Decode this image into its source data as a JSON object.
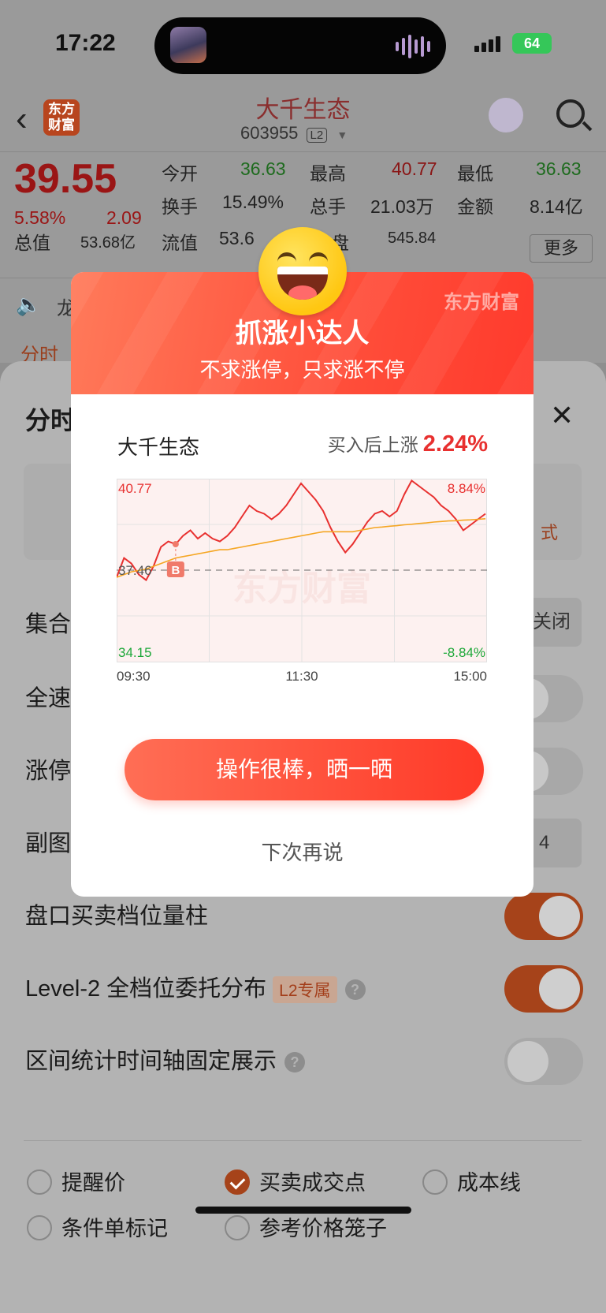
{
  "status": {
    "time": "17:22",
    "battery": "64"
  },
  "nav": {
    "logo_text": "东方\n财富",
    "stock_name": "大千生态",
    "stock_code": "603955",
    "l2_tag": "L2"
  },
  "quote": {
    "price": "39.55",
    "change_pct": "5.58%",
    "change_amt": "2.09",
    "open_label": "今开",
    "open_value": "36.63",
    "high_label": "最高",
    "high_value": "40.77",
    "low_label": "最低",
    "low_value": "36.63",
    "turnover_label": "换手",
    "turnover_value": "15.49%",
    "volume_label": "总手",
    "volume_value": "21.03万",
    "amount_label": "金额",
    "amount_value": "8.14亿",
    "mktcap_label": "总值",
    "mktcap_value": "53.68亿",
    "float_label": "流值",
    "float_value": "53.6",
    "extra_label": "盘",
    "extra_value": "545.84",
    "more_label": "更多"
  },
  "ticker": {
    "text": "龙"
  },
  "tab_partial": "分时",
  "sheet": {
    "title": "分时",
    "rows": [
      {
        "label": "集合",
        "control": "seg",
        "value": "关闭"
      },
      {
        "label": "全速",
        "control": "switch-off"
      },
      {
        "label": "涨停",
        "control": "switch-off"
      },
      {
        "label": "副图",
        "control": "seg",
        "value": "4"
      },
      {
        "label": "盘口买卖档位量柱",
        "control": "switch-on"
      },
      {
        "label": "Level-2 全档位委托分布",
        "badge": "L2专属",
        "help": "?",
        "control": "switch-on"
      },
      {
        "label": "区间统计时间轴固定展示",
        "help": "?",
        "control": "switch-off"
      }
    ],
    "seg_suffix": "式",
    "options": [
      {
        "label": "提醒价",
        "checked": false
      },
      {
        "label": "买卖成交点",
        "checked": true
      },
      {
        "label": "成本线",
        "checked": false
      },
      {
        "label": "条件单标记",
        "checked": false
      },
      {
        "label": "参考价格笼子",
        "checked": false
      }
    ]
  },
  "modal": {
    "brand": "东方财富",
    "title": "抓涨小达人",
    "subtitle": "不求涨停，只求涨不停",
    "stock_name": "大千生态",
    "rise_label": "买入后上涨",
    "rise_value": "2.24%",
    "cta": "操作很棒，晒一晒",
    "later": "下次再说",
    "watermark": "东方财富"
  },
  "chart_data": {
    "type": "line",
    "y_top_label": "40.77",
    "y_mid_label": "37.46",
    "y_bottom_label": "34.15",
    "pct_top_label": "8.84%",
    "pct_bottom_label": "-8.84%",
    "x_labels": [
      "09:30",
      "11:30",
      "15:00"
    ],
    "buy_marker": "B",
    "ylim": [
      34.15,
      40.77
    ],
    "reference": 37.46,
    "series": [
      {
        "name": "price",
        "color": "#e8302f",
        "values": [
          37.2,
          37.9,
          37.7,
          37.3,
          37.1,
          37.6,
          38.3,
          38.5,
          38.4,
          38.7,
          38.9,
          38.6,
          38.8,
          38.6,
          38.5,
          38.7,
          39.0,
          39.4,
          39.8,
          39.6,
          39.5,
          39.3,
          39.5,
          39.8,
          40.2,
          40.6,
          40.3,
          40.0,
          39.6,
          39.0,
          38.5,
          38.1,
          38.4,
          38.8,
          39.2,
          39.5,
          39.6,
          39.4,
          39.6,
          40.2,
          40.7,
          40.5,
          40.3,
          40.1,
          39.8,
          39.6,
          39.3,
          38.9,
          39.1,
          39.3,
          39.5
        ]
      },
      {
        "name": "avg",
        "color": "#f5a623",
        "values": [
          37.2,
          37.3,
          37.4,
          37.45,
          37.5,
          37.6,
          37.7,
          37.8,
          37.9,
          37.95,
          38.0,
          38.05,
          38.1,
          38.15,
          38.2,
          38.2,
          38.25,
          38.3,
          38.35,
          38.4,
          38.45,
          38.5,
          38.55,
          38.6,
          38.65,
          38.7,
          38.75,
          38.8,
          38.85,
          38.85,
          38.85,
          38.85,
          38.85,
          38.9,
          38.95,
          39.0,
          39.02,
          39.05,
          39.07,
          39.1,
          39.12,
          39.15,
          39.17,
          39.2,
          39.22,
          39.24,
          39.25,
          39.27,
          39.28,
          39.3,
          39.32
        ]
      }
    ]
  }
}
